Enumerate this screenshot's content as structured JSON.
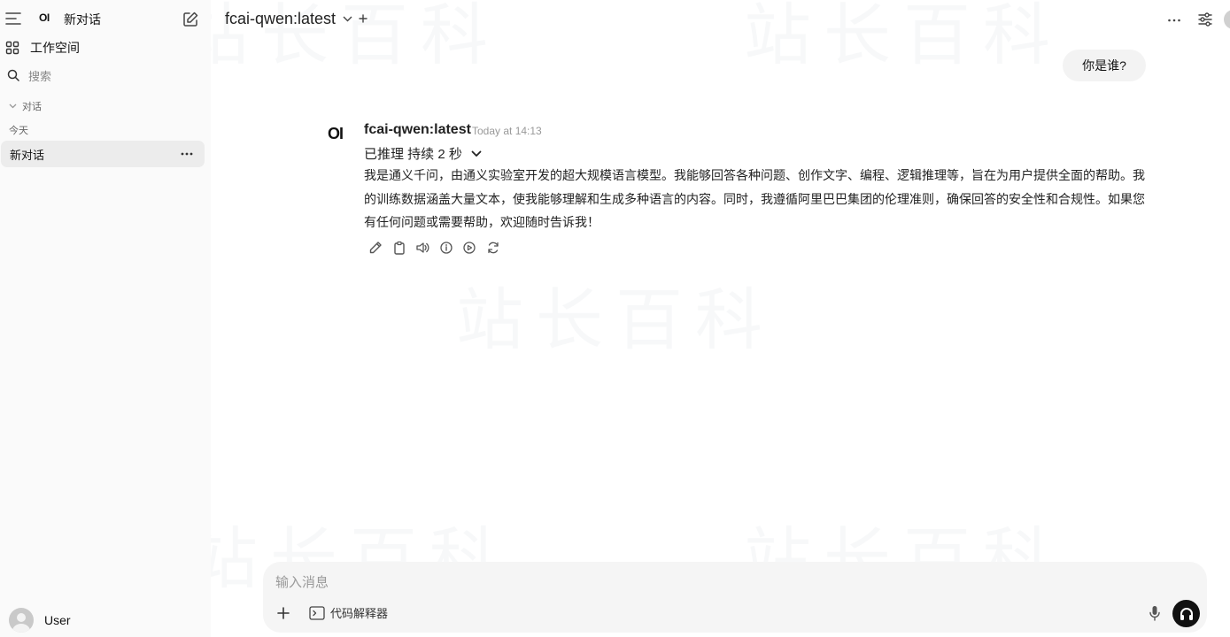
{
  "sidebar": {
    "logo": "OI",
    "new_chat_label": "新对话",
    "workspace_label": "工作空间",
    "search_placeholder": "搜索",
    "section_label": "对话",
    "group_today": "今天",
    "chats": [
      {
        "title": "新对话"
      }
    ],
    "user_name": "User"
  },
  "header": {
    "model_name": "fcai-qwen:latest"
  },
  "conversation": {
    "user_message": "你是谁?",
    "assistant": {
      "logo": "OI",
      "name": "fcai-qwen:latest",
      "time": "Today at 14:13",
      "reasoning_label": "已推理 持续 2 秒",
      "answer": "我是通义千问，由通义实验室开发的超大规模语言模型。我能够回答各种问题、创作文字、编程、逻辑推理等，旨在为用户提供全面的帮助。我的训练数据涵盖大量文本，使我能够理解和生成多种语言的内容。同时，我遵循阿里巴巴集团的伦理准则，确保回答的安全性和合规性。如果您有任何问题或需要帮助，欢迎随时告诉我！",
      "actions": [
        "edit-icon",
        "copy-icon",
        "read-aloud-icon",
        "info-icon",
        "continue-icon",
        "regenerate-icon"
      ]
    }
  },
  "composer": {
    "placeholder": "输入消息",
    "code_interpreter_label": "代码解释器"
  },
  "watermark": "站长百科"
}
